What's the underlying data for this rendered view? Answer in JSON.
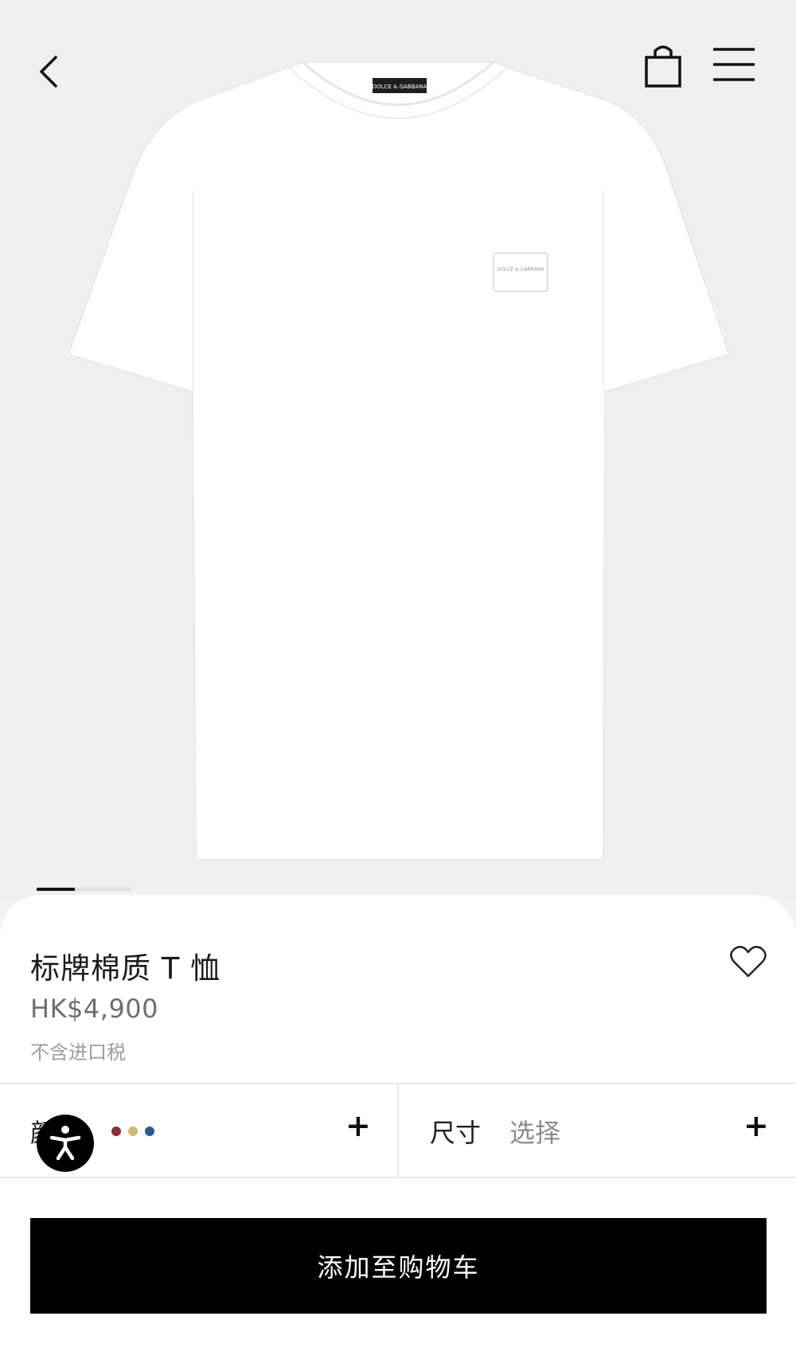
{
  "product": {
    "title": "标牌棉质 T 恤",
    "price": "HK$4,900",
    "tax_note": "不含进口税",
    "image_alt": "white t-shirt",
    "neck_label": "DOLCE & GABBANA",
    "chest_plate": "DOLCE & GABBANA"
  },
  "header": {
    "back_icon": "chevron-left-icon",
    "bag_icon": "shopping-bag-icon",
    "menu_icon": "hamburger-menu-icon"
  },
  "carousel": {
    "active_index": 0,
    "count": 2
  },
  "options": {
    "color_label": "颜",
    "color_swatches": [
      "#8b2e3a",
      "#d2b86a",
      "#2f5796"
    ],
    "color_expand": "+",
    "size_label": "尺寸",
    "size_value": "选择",
    "size_expand": "+"
  },
  "actions": {
    "wishlist_icon": "heart-icon",
    "accessibility_icon": "accessibility-icon",
    "add_to_cart": "添加至购物车"
  }
}
